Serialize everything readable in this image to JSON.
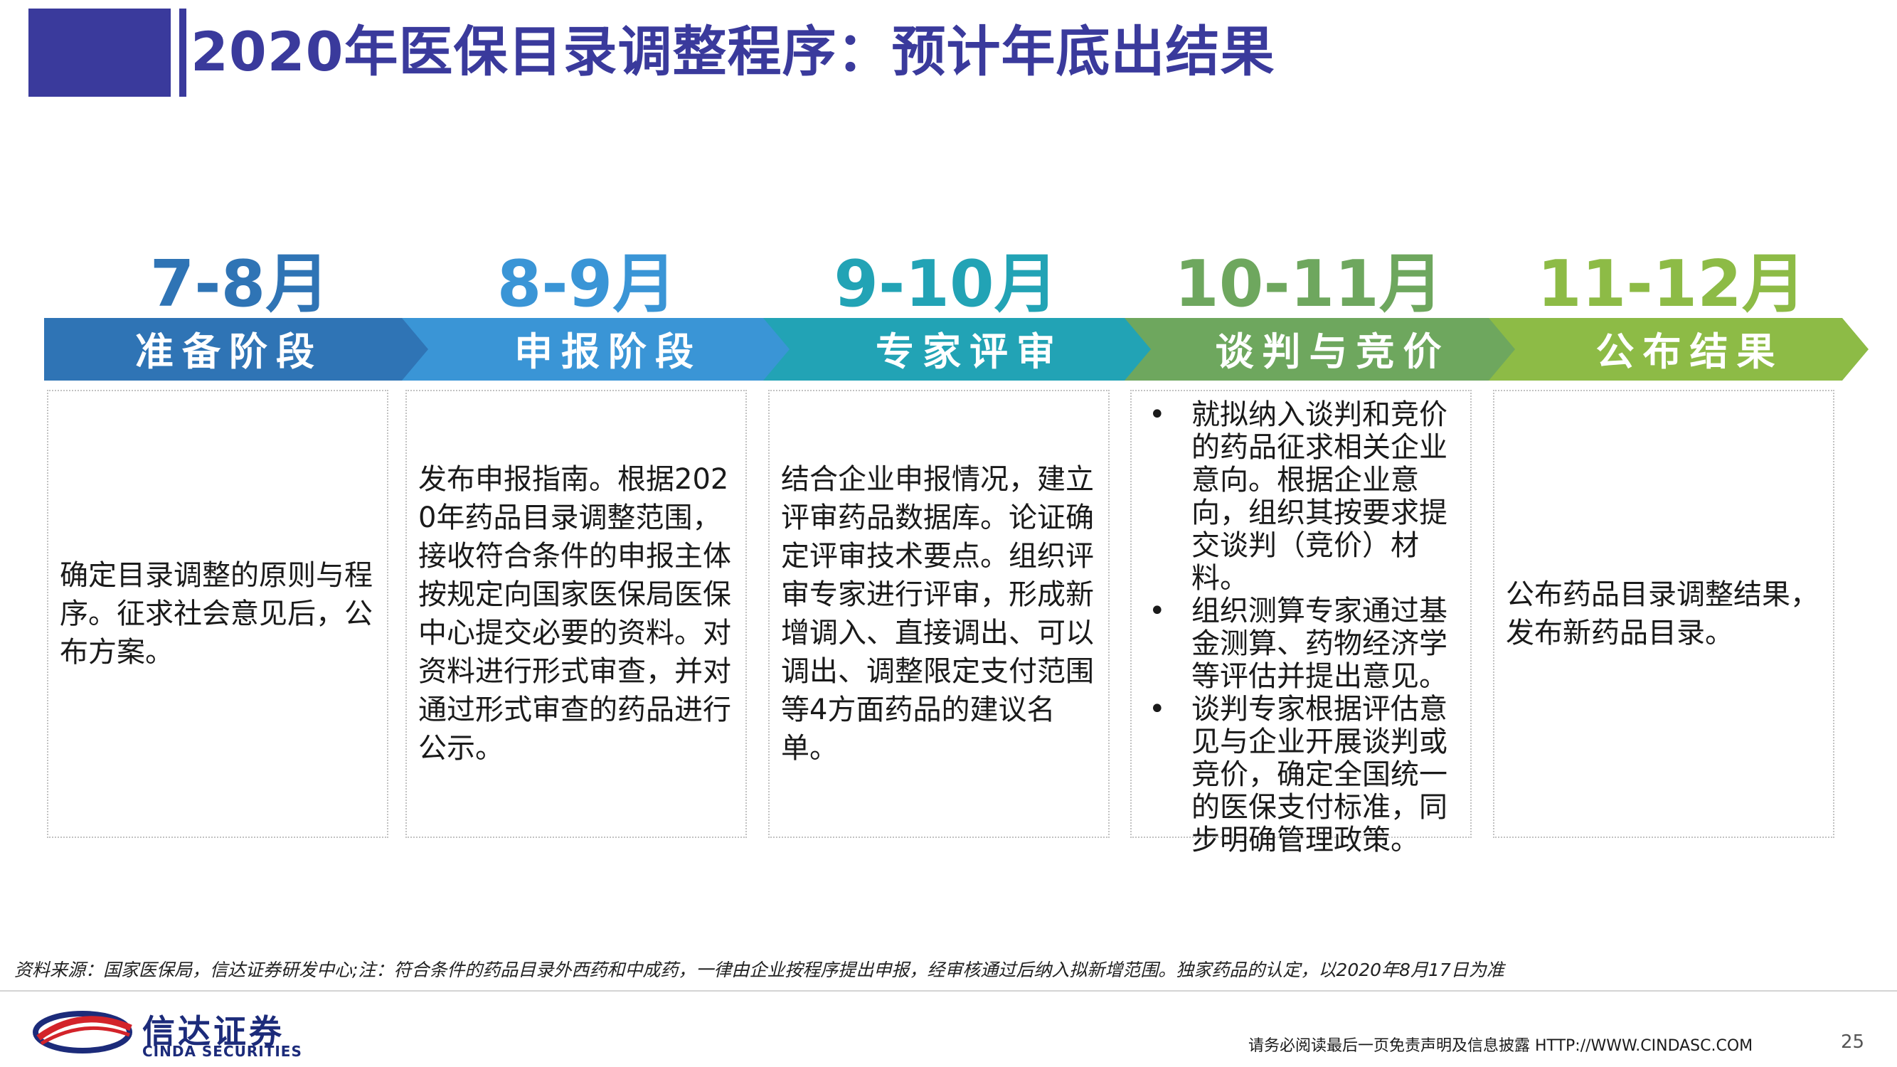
{
  "title": "2020年医保目录调整程序：预计年底出结果",
  "colors": {
    "title": "#3a3a9c",
    "stage1": "#2f74b5",
    "stage2": "#3a95d6",
    "stage3": "#22a3b5",
    "stage4": "#6ea75e",
    "stage5": "#8dbb46"
  },
  "stages": [
    {
      "period": "7-8月",
      "name": "准备阶段",
      "text": "确定目录调整的原则与程序。征求社会意见后，公布方案。"
    },
    {
      "period": "8-9月",
      "name": "申报阶段",
      "text": "发布申报指南。根据2020年药品目录调整范围，接收符合条件的申报主体按规定向国家医保局医保中心提交必要的资料。对资料进行形式审查，并对通过形式审查的药品进行公示。"
    },
    {
      "period": "9-10月",
      "name": "专家评审",
      "text": "结合企业申报情况，建立评审药品数据库。论证确定评审技术要点。组织评审专家进行评审，形成新增调入、直接调出、可以调出、调整限定支付范围等4方面药品的建议名单。"
    },
    {
      "period": "10-11月",
      "name": "谈判与竞价",
      "bullet_char": "•",
      "bullets": [
        "就拟纳入谈判和竞价的药品征求相关企业意向。根据企业意向，组织其按要求提交谈判（竞价）材料。",
        "组织测算专家通过基金测算、药物经济学等评估并提出意见。",
        "谈判专家根据评估意见与企业开展谈判或竞价，确定全国统一的医保支付标准，同步明确管理政策。"
      ]
    },
    {
      "period": "11-12月",
      "name": "公布结果",
      "text": "公布药品目录调整结果，发布新药品目录。"
    }
  ],
  "source_note": "资料来源：国家医保局，信达证券研发中心;注：符合条件的药品目录外西药和中成药，一律由企业按程序提出申报，经审核通过后纳入拟新增范围。独家药品的认定，以2020年8月17日为准",
  "footer": {
    "logo_cn": "信达证券",
    "logo_en": "CINDA SECURITIES",
    "disclaimer": "请务必阅读最后一页免责声明及信息披露   HTTP://WWW.CINDASC.COM",
    "page_number": "25"
  }
}
